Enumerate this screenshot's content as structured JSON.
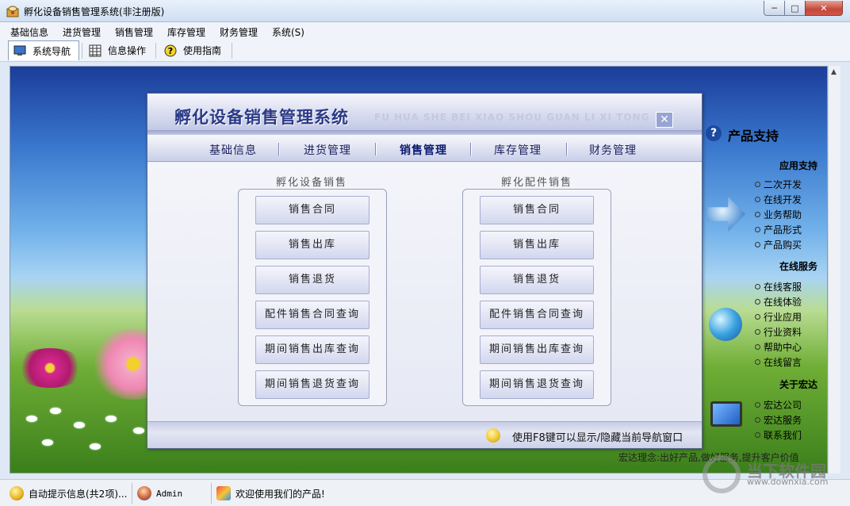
{
  "window": {
    "title": "孵化设备销售管理系统(非注册版)",
    "min_glyph": "─",
    "max_glyph": "□",
    "close_glyph": "✕"
  },
  "menu": [
    "基础信息",
    "进货管理",
    "销售管理",
    "库存管理",
    "财务管理",
    "系统(S)"
  ],
  "toolbar": [
    {
      "label": "系统导航",
      "icon": "monitor-icon",
      "active": true
    },
    {
      "label": "信息操作",
      "icon": "grid-icon",
      "active": false
    },
    {
      "label": "使用指南",
      "icon": "help-icon",
      "active": false
    }
  ],
  "dialog": {
    "title": "孵化设备销售管理系统",
    "subtitle": "FU HUA SHE BEI XIAO SHOU GUAN LI XI TONG",
    "close_glyph": "✕",
    "tabs": [
      {
        "label": "基础信息",
        "selected": false
      },
      {
        "label": "进货管理",
        "selected": false
      },
      {
        "label": "销售管理",
        "selected": true
      },
      {
        "label": "库存管理",
        "selected": false
      },
      {
        "label": "财务管理",
        "selected": false
      }
    ],
    "groups": [
      {
        "title": "孵化设备销售",
        "buttons": [
          "销售合同",
          "销售出库",
          "销售退货",
          "配件销售合同查询",
          "期间销售出库查询",
          "期间销售退货查询"
        ]
      },
      {
        "title": "孵化配件销售",
        "buttons": [
          "销售合同",
          "销售出库",
          "销售退货",
          "配件销售合同查询",
          "期间销售出库查询",
          "期间销售退货查询"
        ]
      }
    ],
    "footer_tip": "使用F8键可以显示/隐藏当前导航窗口"
  },
  "support": {
    "header": "产品支持",
    "sections": [
      {
        "title": "应用支持",
        "links": [
          "二次开发",
          "在线开发",
          "业务帮助",
          "产品形式",
          "产品购买"
        ]
      },
      {
        "title": "在线服务",
        "links": [
          "在线客服",
          "在线体验",
          "行业应用",
          "行业资料",
          "帮助中心",
          "在线留言"
        ]
      },
      {
        "title": "关于宏达",
        "links": [
          "宏达公司",
          "宏达服务",
          "联系我们"
        ]
      }
    ],
    "motto": "宏达理念:出好产品,做好服务,提升客户价值"
  },
  "statusbar": {
    "tip": "自动提示信息(共2项)...",
    "user": "Admin",
    "welcome": "欢迎使用我们的产品!"
  },
  "watermark": {
    "brand": "当下软件园",
    "url": "www.downxia.com"
  }
}
